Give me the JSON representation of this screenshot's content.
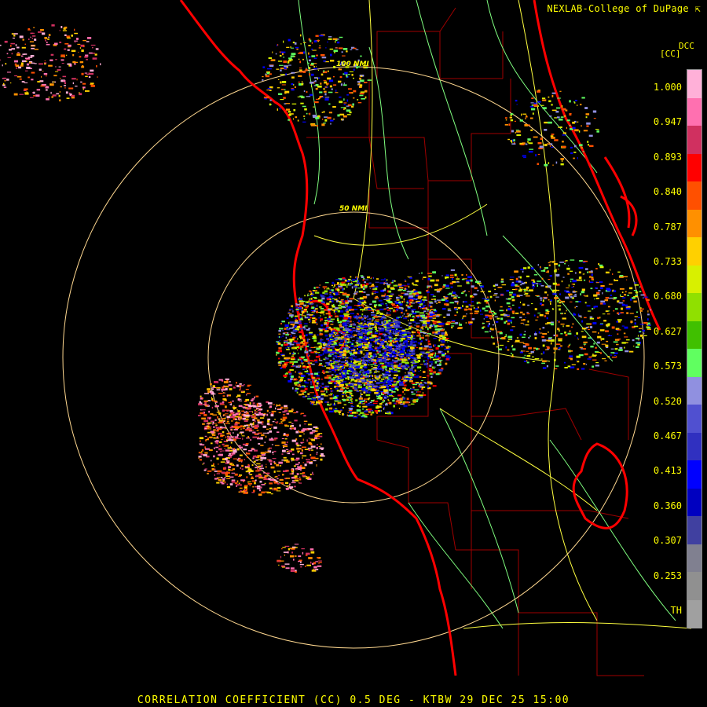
{
  "header": {
    "credit": "NEXLAB-College of DuPage",
    "credit_icon": "cursor-arrow-icon",
    "product_code": "DCC",
    "units": "[CC]"
  },
  "footer": {
    "title": "CORRELATION COEFFICIENT (CC) 0.5 DEG - KTBW 29 DEC 25 15:00"
  },
  "map": {
    "range_ring_labels": [
      "100 NMI",
      "50 NMI"
    ]
  },
  "legend": {
    "ticks": [
      "1.000",
      "0.947",
      "0.893",
      "0.840",
      "0.787",
      "0.733",
      "0.680",
      "0.627",
      "0.573",
      "0.520",
      "0.467",
      "0.413",
      "0.360",
      "0.307",
      "0.253",
      "TH"
    ],
    "colors": [
      "#ffb0d8",
      "#ff70b0",
      "#d03060",
      "#ff0000",
      "#ff5000",
      "#ff9000",
      "#ffd000",
      "#d8f000",
      "#90e000",
      "#40c000",
      "#60ff60",
      "#9090e0",
      "#5050d0",
      "#3030c0",
      "#0000ff",
      "#0000c0",
      "#4040a0",
      "#808090",
      "#909090",
      "#a0a0a0"
    ]
  },
  "colors": {
    "text": "#ffff00",
    "coast": "#ff0000",
    "county": "#a00000",
    "roads": "#ffff40",
    "rivers": "#80ff80",
    "rings": "#ffd890"
  }
}
